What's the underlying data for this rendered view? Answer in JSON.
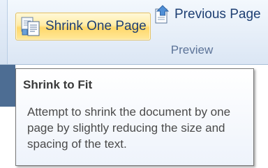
{
  "ribbon": {
    "shrink_button": {
      "label": "Shrink One Page",
      "icon": "shrink-one-page-icon",
      "state": "hover"
    },
    "previous_page_button": {
      "label": "Previous Page",
      "icon": "previous-page-icon"
    },
    "group_label": "Preview"
  },
  "tooltip": {
    "title": "Shrink to Fit",
    "description": "Attempt to shrink the document by one page by slightly reducing the size and spacing of the text."
  },
  "colors": {
    "ribbon_bg": "#e6eef8",
    "hover_gold": "#ffd86b",
    "label_blue": "#1e3f73",
    "group_label": "#5c7398",
    "tooltip_border": "#767676"
  }
}
